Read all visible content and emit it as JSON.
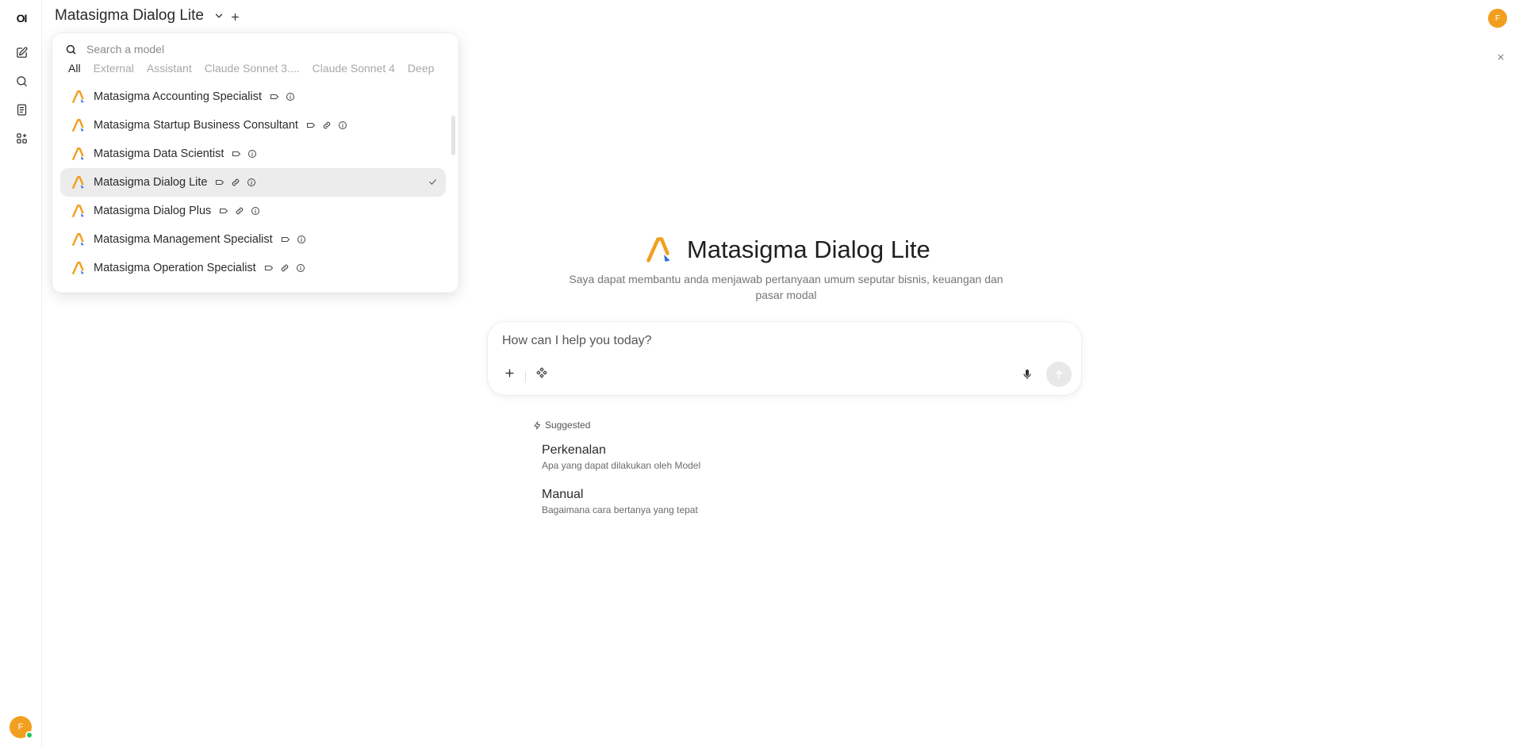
{
  "sidebar": {
    "logo_text": "OI",
    "items": [
      {
        "name": "new-chat",
        "icon": "pencil-square-icon"
      },
      {
        "name": "search",
        "icon": "search-icon"
      },
      {
        "name": "notes",
        "icon": "notes-icon"
      },
      {
        "name": "workspace",
        "icon": "grid-icon"
      }
    ],
    "user_initial": "F"
  },
  "header": {
    "model_title": "Matasigma Dialog Lite",
    "user_initial": "F"
  },
  "model_selector": {
    "search_placeholder": "Search a model",
    "tabs": [
      "All",
      "External",
      "Assistant",
      "Claude Sonnet 3....",
      "Claude Sonnet 4",
      "Deep"
    ],
    "active_tab": "All",
    "items": [
      {
        "label": "Matasigma Accounting Specialist",
        "link": false,
        "selected": false
      },
      {
        "label": "Matasigma Startup Business Consultant",
        "link": true,
        "selected": false
      },
      {
        "label": "Matasigma Data Scientist",
        "link": false,
        "selected": false
      },
      {
        "label": "Matasigma Dialog Lite",
        "link": true,
        "selected": true
      },
      {
        "label": "Matasigma Dialog Plus",
        "link": true,
        "selected": false
      },
      {
        "label": "Matasigma Management Specialist",
        "link": false,
        "selected": false
      },
      {
        "label": "Matasigma Operation Specialist",
        "link": true,
        "selected": false
      }
    ]
  },
  "hero": {
    "title": "Matasigma Dialog Lite",
    "description": "Saya dapat membantu anda menjawab pertanyaan umum seputar bisnis, keuangan dan pasar modal"
  },
  "composer": {
    "placeholder": "How can I help you today?"
  },
  "suggested": {
    "label": "Suggested",
    "items": [
      {
        "title": "Perkenalan",
        "subtitle": "Apa yang dapat dilakukan oleh Model"
      },
      {
        "title": "Manual",
        "subtitle": "Bagaimana cara bertanya yang tepat"
      }
    ]
  },
  "colors": {
    "accent_orange": "#f29f1f",
    "logo_blue": "#2d6be0",
    "status_green": "#22c55e",
    "selected_row": "#ececec"
  }
}
